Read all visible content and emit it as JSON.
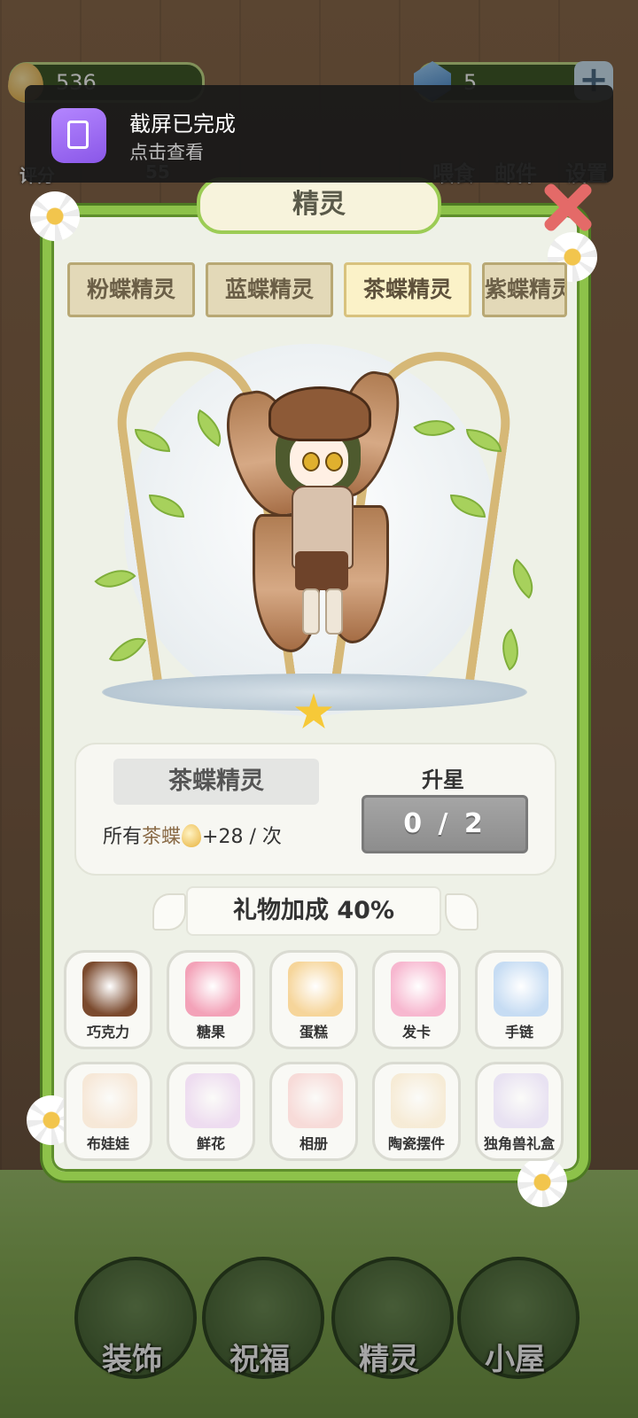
{
  "hud": {
    "coins": "536",
    "gems": "5",
    "plus": "+",
    "rating_label": "评分",
    "rating_value": "55",
    "feed_label": "喂食",
    "mail_label": "邮件",
    "settings_label": "设置"
  },
  "notification": {
    "title": "截屏已完成",
    "subtitle": "点击查看"
  },
  "panel": {
    "title": "精灵",
    "tabs": [
      {
        "label": "粉蝶精灵",
        "active": false
      },
      {
        "label": "蓝蝶精灵",
        "active": false
      },
      {
        "label": "茶蝶精灵",
        "active": true
      },
      {
        "label": "紫蝶精灵",
        "active": false
      }
    ],
    "spirit_name": "茶蝶精灵",
    "desc_prefix": "所有",
    "desc_highlight": "茶蝶",
    "desc_bonus": "+28 / 次",
    "star_up_label": "升星",
    "star_progress": "0 / 2",
    "stars": 1,
    "gift_bonus": "礼物加成 40%",
    "gifts": [
      {
        "label": "巧克力",
        "icon": "chocolate-icon",
        "color": "#7b4a2e",
        "locked": false
      },
      {
        "label": "糖果",
        "icon": "candy-jar-icon",
        "color": "#f3a2b8",
        "locked": false
      },
      {
        "label": "蛋糕",
        "icon": "cake-icon",
        "color": "#f6d59a",
        "locked": false
      },
      {
        "label": "发卡",
        "icon": "bow-icon",
        "color": "#f7b7cf",
        "locked": false
      },
      {
        "label": "手链",
        "icon": "bracelet-icon",
        "color": "#c6dcf3",
        "locked": false
      },
      {
        "label": "布娃娃",
        "icon": "doll-icon",
        "color": "#f2c7a0",
        "locked": true
      },
      {
        "label": "鲜花",
        "icon": "flower-bouquet-icon",
        "color": "#d8a6e6",
        "locked": true
      },
      {
        "label": "相册",
        "icon": "photo-album-icon",
        "color": "#f4a3a3",
        "locked": true
      },
      {
        "label": "陶瓷摆件",
        "icon": "ceramic-cat-icon",
        "color": "#f2d29d",
        "locked": true
      },
      {
        "label": "独角兽礼盒",
        "icon": "unicorn-box-icon",
        "color": "#c9b6ec",
        "locked": true
      }
    ]
  },
  "nav": [
    {
      "label": "装饰",
      "icon": "plant-icon"
    },
    {
      "label": "祝福",
      "icon": "butterfly-icon"
    },
    {
      "label": "精灵",
      "icon": "fairy-icon"
    },
    {
      "label": "小屋",
      "icon": "house-icon"
    }
  ],
  "colors": {
    "panel_border": "#8dc24a",
    "close": "#e46a68",
    "star": "#f6c938"
  }
}
